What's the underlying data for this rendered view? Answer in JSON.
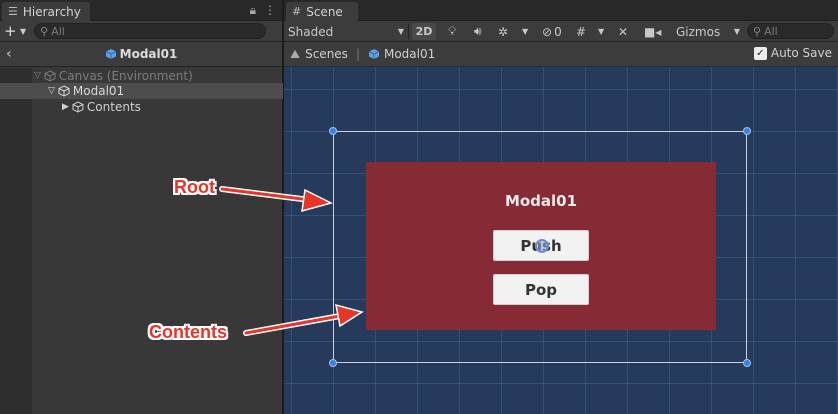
{
  "hierarchy": {
    "tab_label": "Hierarchy",
    "add_label": "+",
    "search_placeholder": "All",
    "breadcrumb_title": "Modal01",
    "tree": [
      {
        "label": "Canvas (Environment)",
        "dim": true
      },
      {
        "label": "Modal01",
        "selected": true
      },
      {
        "label": "Contents"
      }
    ]
  },
  "scene": {
    "tab_label": "Scene",
    "shading_mode": "Shaded",
    "toggle_2d": "2D",
    "hidden_count": "0",
    "gizmos_label": "Gizmos",
    "search_placeholder": "All",
    "breadcrumb": {
      "scenes": "Scenes",
      "prefab": "Modal01"
    },
    "auto_save_label": "Auto Save",
    "auto_save_checked": true,
    "modal_title": "Modal01",
    "buttons": {
      "push": "Push",
      "pop": "Pop"
    },
    "colors": {
      "viewport_bg": "#263b5b",
      "contents_fill": "#862b35",
      "handle": "#3a7ee8"
    }
  },
  "annotations": {
    "root_label": "Root",
    "contents_label": "Contents",
    "color": "#e8352a"
  }
}
